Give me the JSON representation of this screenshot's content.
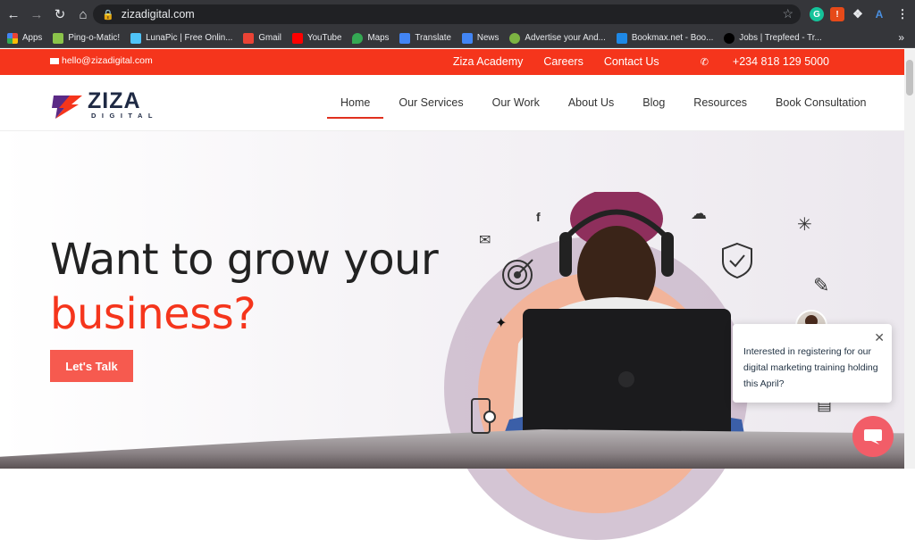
{
  "browser": {
    "url": "zizadigital.com",
    "bookmarks": [
      {
        "label": "Apps",
        "color": "#e8453c"
      },
      {
        "label": "Ping-o-Matic!",
        "color": "#8bc34a"
      },
      {
        "label": "LunaPic | Free Onlin...",
        "color": "#4fc3f7"
      },
      {
        "label": "Gmail",
        "color": "#ea4335"
      },
      {
        "label": "YouTube",
        "color": "#ff0000"
      },
      {
        "label": "Maps",
        "color": "#34a853"
      },
      {
        "label": "Translate",
        "color": "#4285f4"
      },
      {
        "label": "News",
        "color": "#4285f4"
      },
      {
        "label": "Advertise your And...",
        "color": "#7cb342"
      },
      {
        "label": "Bookmax.net - Boo...",
        "color": "#1e88e5"
      },
      {
        "label": "Jobs | Trepfeed - Tr...",
        "color": "#212121"
      }
    ],
    "more": "»"
  },
  "topbar": {
    "email": "hello@zizadigital.com",
    "links": [
      "Ziza Academy",
      "Careers",
      "Contact Us"
    ],
    "phone": "+234 818 129 5000"
  },
  "header": {
    "logo_word": "ZIZA",
    "logo_sub": "DIGITAL",
    "menu": [
      "Home",
      "Our Services",
      "Our Work",
      "About Us",
      "Blog",
      "Resources",
      "Book Consultation"
    ]
  },
  "hero": {
    "line1": "Want to grow your",
    "line2": "business?",
    "cta": "Let's Talk"
  },
  "popup": {
    "text": "Interested in registering for our digital marketing training holding this April?"
  },
  "colors": {
    "accent": "#f5351c",
    "cta": "#f65a4f",
    "navy": "#1f2a44"
  }
}
